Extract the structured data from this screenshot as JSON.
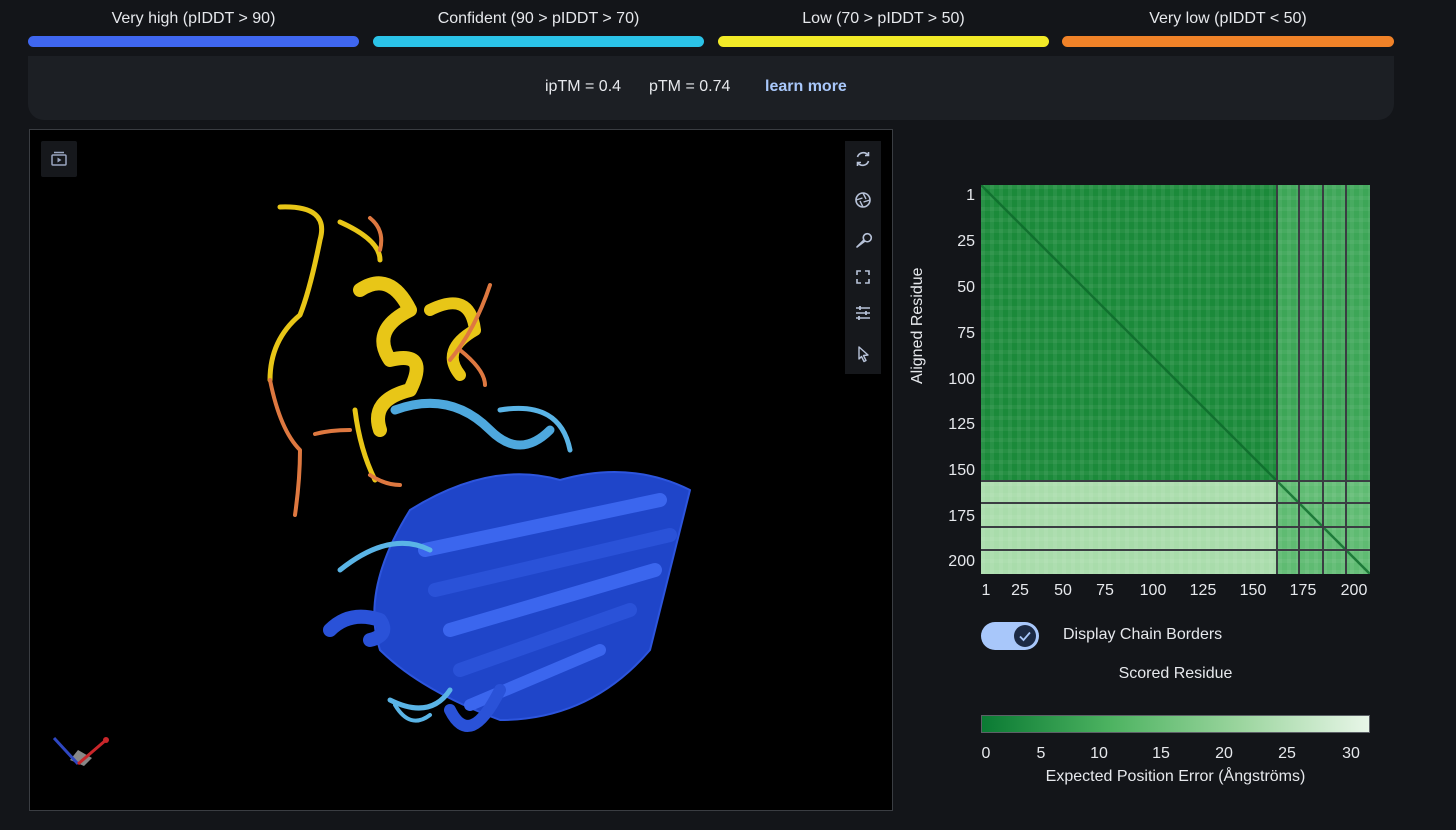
{
  "legend": [
    {
      "label": "Very high (pIDDT > 90)",
      "color": "#3f67f0"
    },
    {
      "label": "Confident (90 > pIDDT > 70)",
      "color": "#2bc3e8"
    },
    {
      "label": "Low (70 > pIDDT > 50)",
      "color": "#f2ea27"
    },
    {
      "label": "Very low (pIDDT < 50)",
      "color": "#f08228"
    }
  ],
  "metrics": {
    "iptm": "ipTM = 0.4",
    "ptm": "pTM = 0.74",
    "learn_more": "learn more"
  },
  "viewer": {
    "tools": [
      "video-icon",
      "refresh-icon",
      "camera-shutter-icon",
      "wrench-icon",
      "fullscreen-icon",
      "sliders-icon",
      "pointer-icon"
    ]
  },
  "pae": {
    "ylabel": "Aligned Residue",
    "xlabel": "Scored Residue",
    "ticks": [
      "1",
      "25",
      "50",
      "75",
      "100",
      "125",
      "150",
      "175",
      "200"
    ],
    "toggle_label": "Display Chain Borders",
    "toggle_on": true,
    "colorbar_ticks": [
      "0",
      "5",
      "10",
      "15",
      "20",
      "25",
      "30"
    ],
    "colorbar_label": "Expected Position Error (Ångströms)",
    "colors": {
      "low": "#0a7a33",
      "high": "#e8f6e8"
    }
  }
}
